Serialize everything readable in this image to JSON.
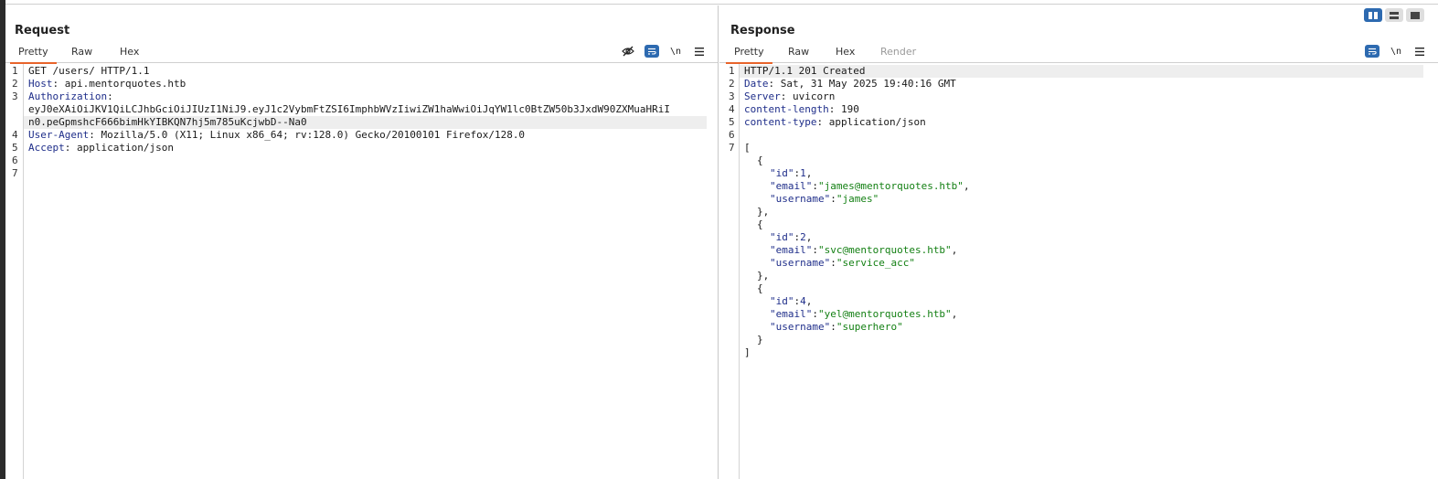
{
  "request": {
    "title": "Request",
    "tabs": [
      {
        "label": "Pretty",
        "active": true
      },
      {
        "label": "Raw",
        "active": false
      },
      {
        "label": "Hex",
        "active": false
      }
    ],
    "tools": {
      "hide_icon": "eye-slash-icon",
      "wrap_icon": "wrap-lines-icon",
      "newline_label": "\\n",
      "menu_icon": "hamburger-menu-icon"
    },
    "line_numbers": [
      "1",
      "2",
      "3",
      "4",
      "5",
      "6",
      "7"
    ],
    "lines": {
      "request_line": "GET /users/ HTTP/1.1",
      "host_key": "Host",
      "host_value": ": api.mentorquotes.htb",
      "auth_key": "Authorization",
      "auth_colon": ":",
      "auth_token_part1": "eyJ0eXAiOiJKV1QiLCJhbGciOiJIUzI1NiJ9.eyJ1c2VybmFtZSI6ImphbWVzIiwiZW1haWwiOiJqYW1lc0BtZW50b3JxdW90ZXMuaHRiI",
      "auth_token_part2": "n0.peGpmshcF666bimHkYIBKQN7hj5m785uKcjwbD--Na0",
      "ua_key": "User-Agent",
      "ua_value": ": Mozilla/5.0 (X11; Linux x86_64; rv:128.0) Gecko/20100101 Firefox/128.0",
      "accept_key": "Accept",
      "accept_value": ": application/json"
    }
  },
  "response": {
    "title": "Response",
    "tabs": [
      {
        "label": "Pretty",
        "active": true
      },
      {
        "label": "Raw",
        "active": false
      },
      {
        "label": "Hex",
        "active": false
      },
      {
        "label": "Render",
        "active": false,
        "disabled": true
      }
    ],
    "tools": {
      "wrap_icon": "wrap-lines-icon",
      "newline_label": "\\n",
      "menu_icon": "hamburger-menu-icon"
    },
    "line_numbers": [
      "1",
      "2",
      "3",
      "4",
      "5",
      "6",
      "7"
    ],
    "headers": {
      "status_line": "HTTP/1.1 201 Created",
      "date_key": "Date",
      "date_value": ": Sat, 31 May 2025 19:40:16 GMT",
      "server_key": "Server",
      "server_value": ": uvicorn",
      "length_key": "content-length",
      "length_value": ": 190",
      "type_key": "content-type",
      "type_value": ": application/json"
    },
    "body": {
      "open_bracket": "[",
      "close_bracket": "]",
      "users": [
        {
          "id": "1",
          "email": "\"james@mentorquotes.htb\"",
          "username": "\"james\""
        },
        {
          "id": "2",
          "email": "\"svc@mentorquotes.htb\"",
          "username": "\"service_acc\""
        },
        {
          "id": "4",
          "email": "\"yel@mentorquotes.htb\"",
          "username": "\"superhero\""
        }
      ],
      "key_id": "\"id\"",
      "key_email": "\"email\"",
      "key_username": "\"username\""
    }
  },
  "layout_toggle": {
    "icons": [
      "split-vertical-icon",
      "split-horizontal-icon",
      "single-pane-icon"
    ],
    "active": 0
  },
  "colors": {
    "accent": "#e8642b",
    "selected_blue": "#2d6ab0",
    "header_key": "#1f2e8a",
    "string_value": "#148014"
  }
}
